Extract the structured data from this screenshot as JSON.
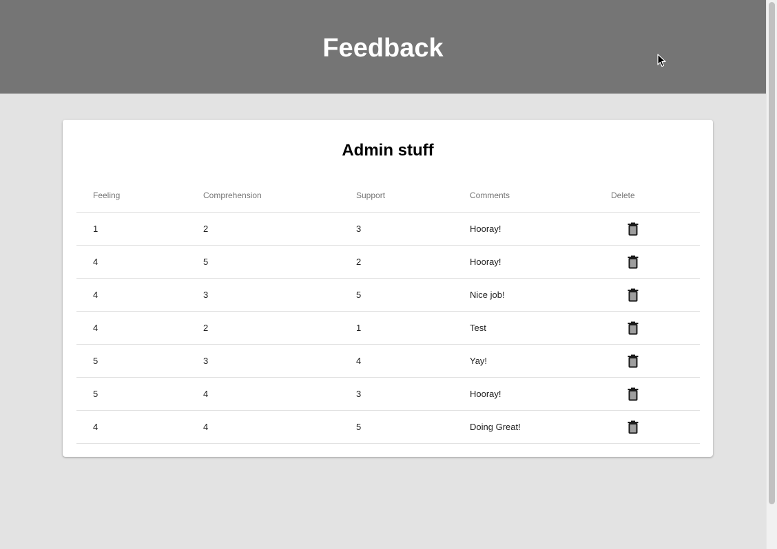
{
  "header": {
    "title": "Feedback"
  },
  "card": {
    "title": "Admin stuff",
    "columns": [
      "Feeling",
      "Comprehension",
      "Support",
      "Comments",
      "Delete"
    ],
    "rows": [
      {
        "feeling": "1",
        "comprehension": "2",
        "support": "3",
        "comments": "Hooray!"
      },
      {
        "feeling": "4",
        "comprehension": "5",
        "support": "2",
        "comments": "Hooray!"
      },
      {
        "feeling": "4",
        "comprehension": "3",
        "support": "5",
        "comments": "Nice job!"
      },
      {
        "feeling": "4",
        "comprehension": "2",
        "support": "1",
        "comments": "Test"
      },
      {
        "feeling": "5",
        "comprehension": "3",
        "support": "4",
        "comments": "Yay!"
      },
      {
        "feeling": "5",
        "comprehension": "4",
        "support": "3",
        "comments": "Hooray!"
      },
      {
        "feeling": "4",
        "comprehension": "4",
        "support": "5",
        "comments": "Doing Great!"
      }
    ],
    "delete_icon": "trash-icon"
  },
  "colors": {
    "header_bg": "#757575",
    "page_bg": "#e3e3e3",
    "card_bg": "#ffffff"
  }
}
